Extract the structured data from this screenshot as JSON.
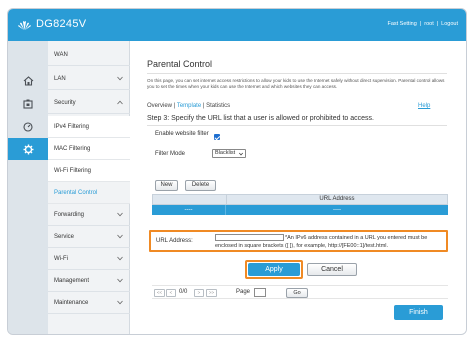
{
  "header": {
    "brand": "DG8245V",
    "links": [
      "Fast Setting",
      "|",
      "root",
      "|",
      "Logout"
    ]
  },
  "rail": {
    "icons": [
      "home-icon",
      "sitemap-icon",
      "gauge-icon",
      "gear-icon"
    ],
    "active_index": 3
  },
  "menu": {
    "wan": "WAN",
    "lan": "LAN",
    "security": "Security",
    "security_sub": [
      "IPv4 Filtering",
      "MAC Filtering",
      "Wi-Fi Filtering",
      "Parental Control"
    ],
    "forwarding": "Forwarding",
    "service": "Service",
    "wifi": "Wi-Fi",
    "management": "Management",
    "maintenance": "Maintenance"
  },
  "page": {
    "title": "Parental Control",
    "description": "On this page, you can set internet access restrictions to allow your kids to use the Internet safely without direct supervision. Parental control allows you to set the times when your kids can use the Internet and which websites they can access.",
    "tabs": {
      "overview": "Overview",
      "sep": "|",
      "template": "Template",
      "statistics": "Statistics"
    },
    "help": "Help",
    "step": "Step 3: Specify the URL list that a user is allowed or prohibited to access."
  },
  "form": {
    "enable_label": "Enable website filter",
    "enable_checked": true,
    "mode_label": "Filter Mode",
    "mode_value": "Blacklist"
  },
  "buttons": {
    "new": "New",
    "delete": "Delete",
    "apply": "Apply",
    "cancel": "Cancel",
    "go": "Go",
    "finish": "Finish"
  },
  "table": {
    "header": "URL Address",
    "row": [
      "----",
      "----"
    ]
  },
  "url_entry": {
    "label": "URL Address:",
    "value": "",
    "note": "*An IPv6 address contained in a URL you entered must be enclosed in square brackets ([ ]), for example, http://[FE00::1]/test.html."
  },
  "pager": {
    "first": "<<",
    "prev": "<",
    "count": "0/0",
    "next": ">",
    "last": ">>",
    "page_label": "Page",
    "page_value": ""
  },
  "colors": {
    "brand_blue": "#2a9cd6",
    "highlight_orange": "#f08a24"
  }
}
